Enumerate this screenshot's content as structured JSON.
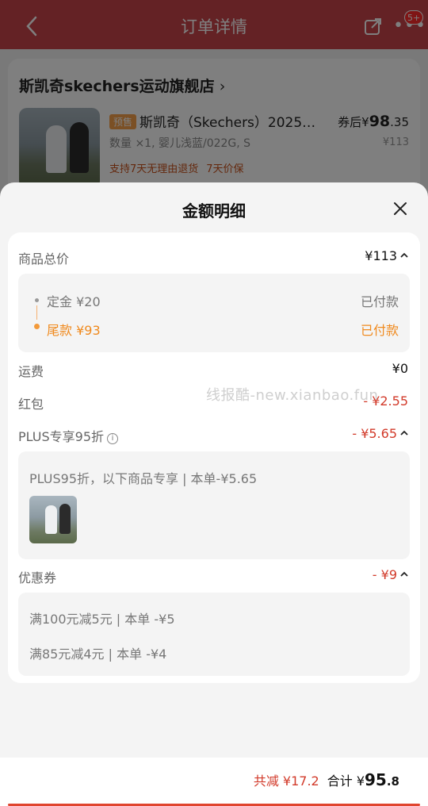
{
  "background": {
    "page_title": "订单详情",
    "notification_badge": "5+",
    "shop_name": "斯凯奇skechers运动旗舰店",
    "product": {
      "tag": "预售",
      "title": "斯凯奇（Skechers）2025…",
      "spec": "数量 ×1, 婴儿浅蓝/022G, S",
      "services": [
        "支持7天无理由退货",
        "7天价保"
      ],
      "price_prefix": "券后¥",
      "price_int": "98",
      "price_dec": ".35",
      "original_price": "¥113"
    }
  },
  "sheet": {
    "title": "金额明细",
    "total_goods": {
      "label": "商品总价",
      "value": "¥113"
    },
    "deposit": {
      "label": "定金 ¥20",
      "status": "已付款"
    },
    "balance": {
      "label": "尾款 ¥93",
      "status": "已付款"
    },
    "shipping": {
      "label": "运费",
      "value": "¥0"
    },
    "red_packet": {
      "label": "红包",
      "value": "- ¥2.55"
    },
    "plus": {
      "label": "PLUS专享95折",
      "value": "- ¥5.65",
      "desc": "PLUS95折，以下商品专享 | 本单-¥5.65"
    },
    "coupon": {
      "label": "优惠券",
      "value": "- ¥9",
      "items": [
        "满100元减5元 | 本单 -¥5",
        "满85元减4元 | 本单 -¥4"
      ]
    },
    "watermark": "线报酷-new.xianbao.fun"
  },
  "footer": {
    "saving": "共减 ¥17.2",
    "total_label": "合计 ¥",
    "total_int": "95",
    "total_dec": ".8"
  },
  "colors": {
    "accent_red": "#d23a2a",
    "orange": "#f08a1e",
    "header_red": "#c8454a"
  }
}
